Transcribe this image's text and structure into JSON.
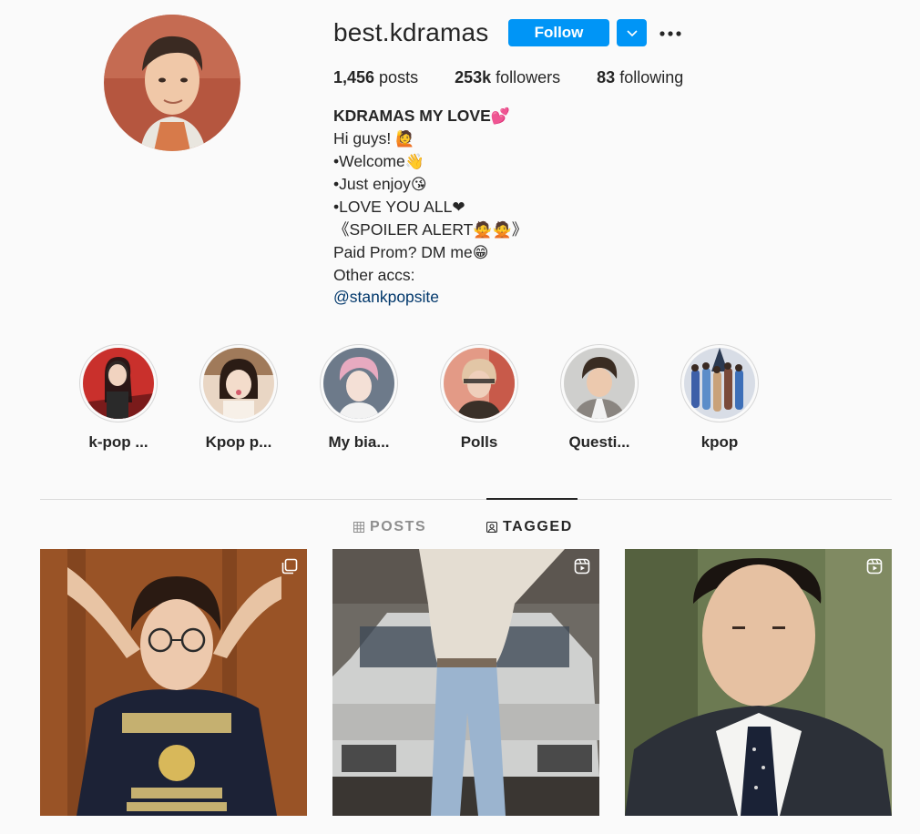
{
  "profile": {
    "username": "best.kdramas",
    "follow_label": "Follow",
    "posts_count": "1,456",
    "posts_label": " posts",
    "followers_count": "253k",
    "followers_label": " followers",
    "following_count": "83",
    "following_label": " following"
  },
  "bio": {
    "name": "KDRAMAS MY LOVE",
    "name_emoji": "💕",
    "line1": "Hi guys! ",
    "line1_emoji": "🙋",
    "line2": "•Welcome",
    "line2_emoji": "👋",
    "line3": "•Just enjoy",
    "line3_emoji": "😘",
    "line4": "•LOVE YOU ALL",
    "line4_emoji": "❤",
    "line5": "《SPOILER ALERT",
    "line5_emoji": "🙅🙅",
    "line5_end": "》",
    "line6": "Paid Prom? DM me",
    "line6_emoji": "😁",
    "line7": "Other accs:",
    "link": "@stankpopsite"
  },
  "highlights": [
    {
      "label": "k-pop ...",
      "icon": "highlight-photo"
    },
    {
      "label": "Kpop p...",
      "icon": "highlight-photo"
    },
    {
      "label": "My bia...",
      "icon": "highlight-photo"
    },
    {
      "label": "Polls",
      "icon": "highlight-photo"
    },
    {
      "label": "Questi...",
      "icon": "highlight-photo"
    },
    {
      "label": "kpop",
      "icon": "highlight-photo"
    }
  ],
  "tabs": {
    "posts": "POSTS",
    "tagged": "TAGGED"
  },
  "colors": {
    "accent": "#0095f6",
    "link": "#00376b",
    "text": "#262626",
    "muted": "#8e8e8e",
    "background": "#fafafa"
  },
  "icons": {
    "dropdown": "chevron-down-icon",
    "more": "more-options-icon",
    "posts_tab": "grid-icon",
    "tagged_tab": "tagged-person-icon",
    "post1_badge": "multiple-posts-icon",
    "post2_badge": "reels-icon",
    "post3_badge": "reels-icon"
  }
}
